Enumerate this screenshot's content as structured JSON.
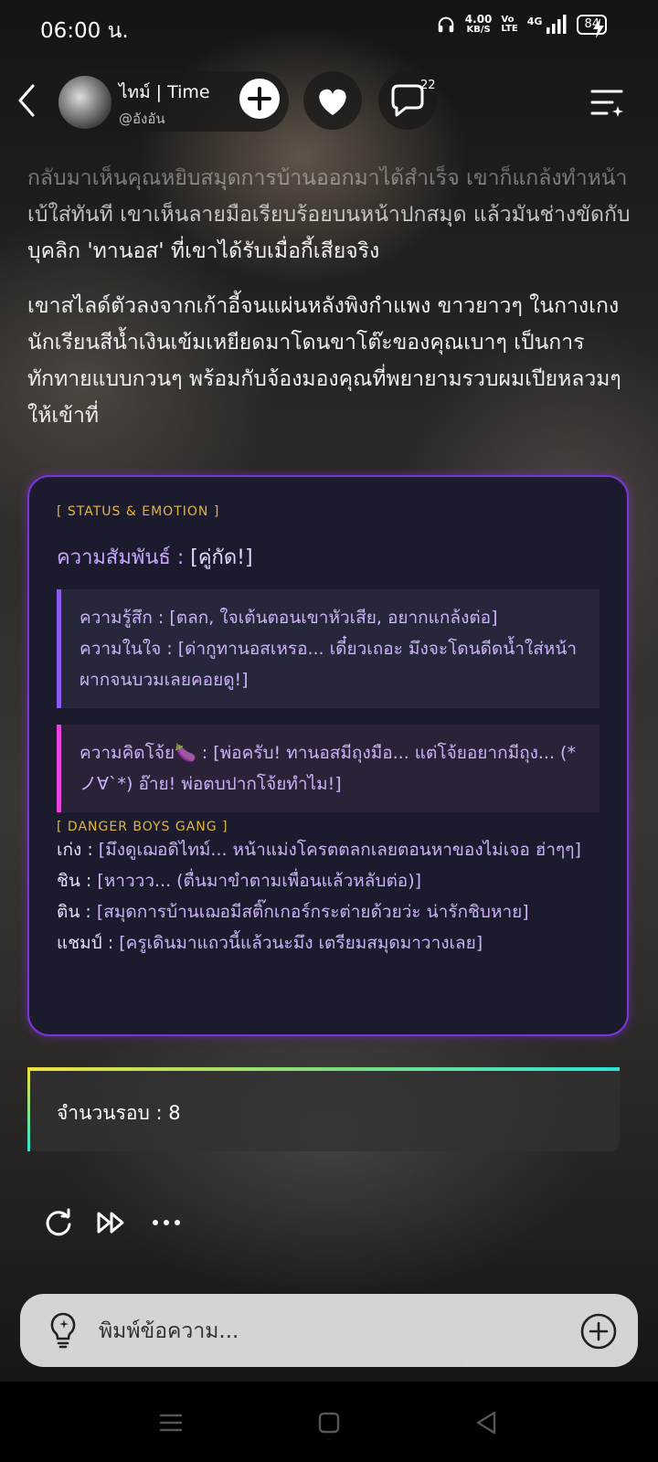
{
  "status_bar": {
    "time": "06:00 น.",
    "net_speed_value": "4.00",
    "net_speed_unit": "KB/S",
    "volte_top": "Vo",
    "volte_bottom": "LTE",
    "network": "4G",
    "battery": "84"
  },
  "header": {
    "character_name": "ไทม์ | Time",
    "character_handle": "@อังอัน",
    "comment_count": "22"
  },
  "story": {
    "paragraphs": [
      "กลับมาเห็นคุณหยิบสมุดการบ้านออกมาได้สำเร็จ เขาก็แกล้งทำหน้าเบ้ใส่ทันที เขาเห็นลายมือเรียบร้อยบนหน้าปกสมุด แล้วมันช่างขัดกับบุคลิก 'ทานอส' ที่เขาได้รับเมื่อกี้เสียจริง",
      "เขาสไลด์ตัวลงจากเก้าอี้จนแผ่นหลังพิงกำแพง ขาวยาวๆ ในกางเกงนักเรียนสีน้ำเงินเข้มเหยียดมาโดนขาโต๊ะของคุณเบาๆ เป็นการทักทายแบบกวนๆ พร้อมกับจ้องมองคุณที่พยายามรวบผมเปียหลวมๆ ให้เข้าที่"
    ]
  },
  "status_card": {
    "header": "[ STATUS & EMOTION ]",
    "relationship_label": "ความสัมพันธ์ :",
    "relationship_value": "[คู่กัด!]",
    "feeling": "ความรู้สึก : [ตลก, ใจเต้นตอนเขาหัวเสีย, อยากแกล้งต่อ]",
    "inner_thought": "ความในใจ : [ด่ากูทานอสเหรอ... เดี๋ยวเถอะ มึงจะโดนดีดน้ำใส่หน้าผากจนบวมเลยคอยดู!]",
    "naughty_thought": "ความคิดโจ้ย🍆 : [พ่อครับ! ทานอสมีถุงมือ... แต่โจ้ยอยากมีถุง... (*ノ∀`*) อ๊าย! พ่อตบปากโจ้ยทำไม!]",
    "gang_header": "[ DANGER BOYS GANG ]",
    "gang": [
      {
        "who": "เก่ง :",
        "text": "[มึงดูเฌอดิไทม์... หน้าแม่งโครตตลกเลยตอนหาของไม่เจอ ฮ่าๆๆ]"
      },
      {
        "who": "ชิน :",
        "text": "[หาววว... (ตื่นมาขำตามเพื่อนแล้วหลับต่อ)]"
      },
      {
        "who": "ติน :",
        "text": "[สมุดการบ้านเฌอมีสติ๊กเกอร์กระต่ายด้วยว่ะ น่ารักชิบหาย]"
      },
      {
        "who": "แชมป์ :",
        "text": "[ครูเดินมาแถวนี้แล้วนะมึง เตรียมสมุดมาวางเลย]"
      }
    ]
  },
  "round": {
    "label": "จำนวนรอบ : 8"
  },
  "composer": {
    "placeholder": "พิมพ์ข้อความ..."
  },
  "icons": {
    "back": "chevron-left-icon",
    "add": "plus-icon",
    "heart": "heart-icon",
    "comment": "comment-icon",
    "menu": "menu-sparkle-icon",
    "regenerate": "refresh-icon",
    "continue": "fast-forward-icon",
    "more": "more-icon",
    "hint": "lightbulb-icon",
    "attach": "plus-circle-icon"
  }
}
